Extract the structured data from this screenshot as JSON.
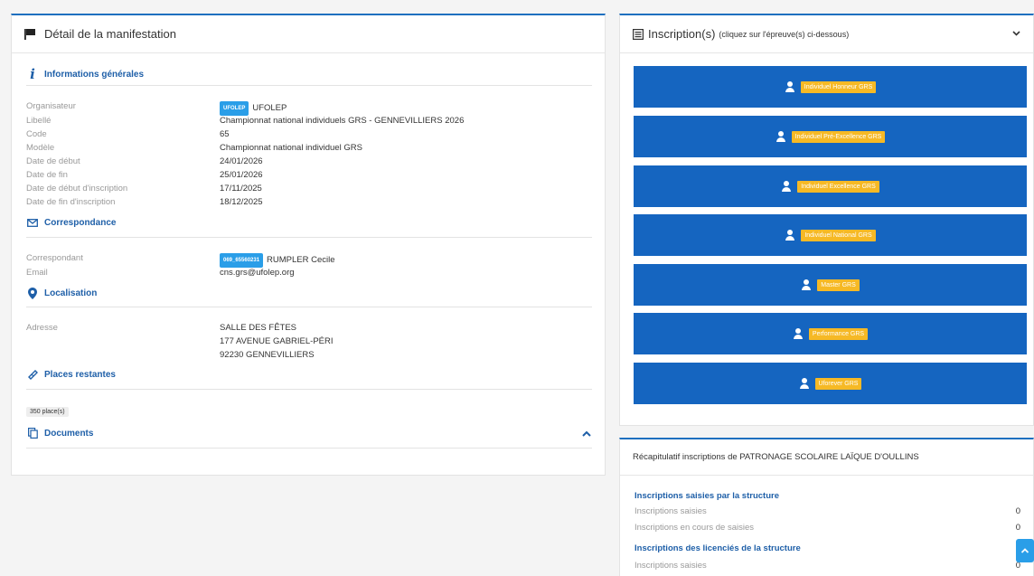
{
  "left": {
    "title": "Détail de la manifestation",
    "general": {
      "title": "Informations générales",
      "rows": [
        {
          "label": "Organisateur",
          "tag": "UFOLEP",
          "value": "UFOLEP"
        },
        {
          "label": "Libellé",
          "value": "Championnat national individuels GRS - GENNEVILLIERS 2026"
        },
        {
          "label": "Code",
          "value": "65"
        },
        {
          "label": "Modèle",
          "value": "Championnat national individuel GRS"
        },
        {
          "label": "Date de début",
          "value": "24/01/2026"
        },
        {
          "label": "Date de fin",
          "value": "25/01/2026"
        },
        {
          "label": "Date de début d'inscription",
          "value": "17/11/2025"
        },
        {
          "label": "Date de fin d'inscription",
          "value": "18/12/2025"
        }
      ]
    },
    "correspondance": {
      "title": "Correspondance",
      "rows": [
        {
          "label": "Correspondant",
          "tag": "069_65560231",
          "value": "RUMPLER Cecile"
        },
        {
          "label": "Email",
          "value": "cns.grs@ufolep.org"
        }
      ]
    },
    "localisation": {
      "title": "Localisation",
      "label": "Adresse",
      "lines": [
        "SALLE DES FÊTES",
        "177 AVENUE GABRIEL-PÉRI",
        "92230 GENNEVILLIERS"
      ]
    },
    "places": {
      "title": "Places restantes",
      "value": "350 place(s)"
    },
    "documents": {
      "title": "Documents"
    }
  },
  "inscriptions": {
    "title": "Inscription(s)",
    "hint": "(cliquez sur l'épreuve(s) ci-dessous)",
    "epreuves": [
      "Individuel Honneur GRS",
      "Individuel Pré-Excellence GRS",
      "Individuel Excellence GRS",
      "Individuel National GRS",
      "Master GRS",
      "Performance GRS",
      "Uforever GRS"
    ]
  },
  "recap": {
    "title": "Récapitulatif inscriptions de PATRONAGE SCOLAIRE LAÏQUE D'OULLINS",
    "structure": {
      "title": "Inscriptions saisies par la structure",
      "rows": [
        {
          "label": "Inscriptions saisies",
          "value": "0"
        },
        {
          "label": "Inscriptions en cours de saisies",
          "value": "0"
        }
      ]
    },
    "licencies": {
      "title": "Inscriptions des licenciés de la structure",
      "rows": [
        {
          "label": "Inscriptions saisies",
          "value": "0"
        }
      ]
    }
  },
  "colors": {
    "accent": "#1565c0",
    "badge": "#f6b925",
    "tag": "#2a9ee8"
  }
}
